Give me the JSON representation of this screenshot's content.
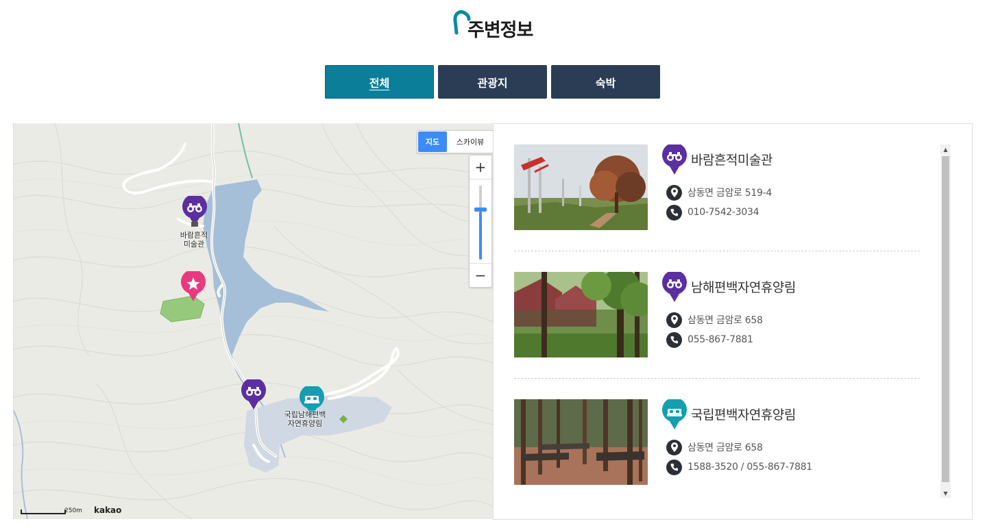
{
  "page": {
    "title": "주변정보"
  },
  "tabs": [
    {
      "label": "전체",
      "active": true
    },
    {
      "label": "관광지",
      "active": false
    },
    {
      "label": "숙박",
      "active": false
    }
  ],
  "map": {
    "type_control": {
      "map": "지도",
      "skyview": "스카이뷰"
    },
    "zoom": {
      "plus": "+",
      "minus": "−"
    },
    "labels": {
      "gallery": [
        "바람흔적",
        "미술관"
      ],
      "forest": [
        "국립남해편백",
        "자연휴양림"
      ]
    },
    "scale": "250m",
    "logo": "kakao"
  },
  "items": [
    {
      "name": "바람흔적미술관",
      "category": "tour",
      "address": "삼동면 금암로 519-4",
      "phone": "010-7542-3034"
    },
    {
      "name": "남해편백자연휴양림",
      "category": "tour",
      "address": "삼동면 금암로 658",
      "phone": "055-867-7881"
    },
    {
      "name": "국립편백자연휴양림",
      "category": "lodging",
      "address": "삼동면 금암로 658",
      "phone": "1588-3520 / 055-867-7881"
    }
  ],
  "colors": {
    "tour": "#5b2fa0",
    "lodging": "#139fb0",
    "star": "#e8397f",
    "active_tab": "#0b7f99",
    "tab": "#2b3d55"
  },
  "icons": {
    "tour": "binoculars-icon",
    "lodging": "bed-icon",
    "star": "star-icon",
    "address": "location-pin-icon",
    "phone": "phone-icon"
  }
}
